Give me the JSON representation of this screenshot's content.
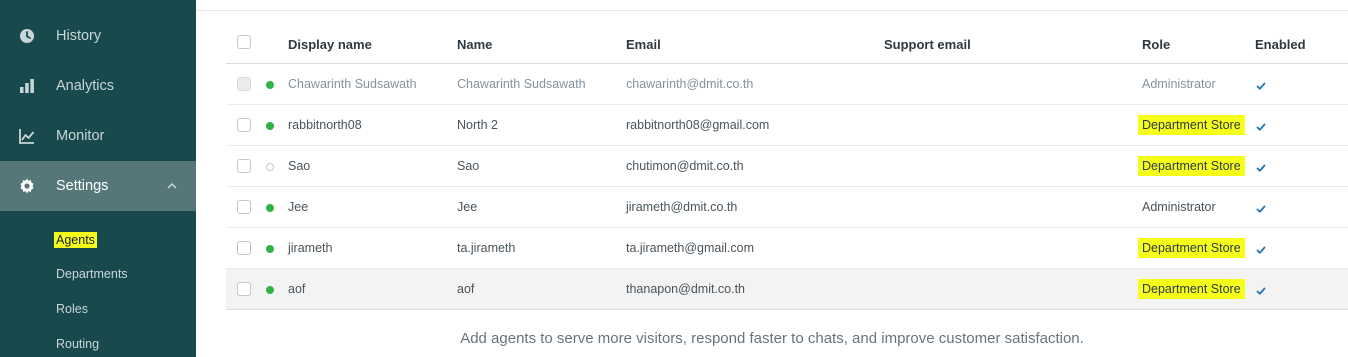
{
  "sidebar": {
    "items": [
      {
        "label": "History",
        "icon": "clock-icon"
      },
      {
        "label": "Analytics",
        "icon": "bar-chart-icon"
      },
      {
        "label": "Monitor",
        "icon": "line-chart-icon"
      },
      {
        "label": "Settings",
        "icon": "gear-icon",
        "active": true
      }
    ],
    "submenu": [
      {
        "label": "Agents",
        "active": true
      },
      {
        "label": "Departments"
      },
      {
        "label": "Roles"
      },
      {
        "label": "Routing"
      }
    ]
  },
  "table": {
    "headers": {
      "display_name": "Display name",
      "name": "Name",
      "email": "Email",
      "support_email": "Support email",
      "role": "Role",
      "enabled": "Enabled"
    },
    "rows": [
      {
        "display_name": "Chawarinth Sudsawath",
        "name": "Chawarinth Sudsawath",
        "email": "chawarinth@dmit.co.th",
        "support_email": "",
        "role": "Administrator",
        "status": "online",
        "enabled": true,
        "highlighted_role": false,
        "muted": true
      },
      {
        "display_name": "rabbitnorth08",
        "name": "North 2",
        "email": "rabbitnorth08@gmail.com",
        "support_email": "",
        "role": "Department Store",
        "status": "online",
        "enabled": true,
        "highlighted_role": true,
        "muted": false
      },
      {
        "display_name": "Sao",
        "name": "Sao",
        "email": "chutimon@dmit.co.th",
        "support_email": "",
        "role": "Department Store",
        "status": "offline",
        "enabled": true,
        "highlighted_role": true,
        "muted": false
      },
      {
        "display_name": "Jee",
        "name": "Jee",
        "email": "jirameth@dmit.co.th",
        "support_email": "",
        "role": "Administrator",
        "status": "online",
        "enabled": true,
        "highlighted_role": false,
        "muted": false
      },
      {
        "display_name": "jirameth",
        "name": "ta.jirameth",
        "email": "ta.jirameth@gmail.com",
        "support_email": "",
        "role": "Department Store",
        "status": "online",
        "enabled": true,
        "highlighted_role": true,
        "muted": false
      },
      {
        "display_name": "aof",
        "name": "aof",
        "email": "thanapon@dmit.co.th",
        "support_email": "",
        "role": "Department Store",
        "status": "online",
        "enabled": true,
        "highlighted_role": true,
        "muted": false
      }
    ]
  },
  "footer_message": "Add agents to serve more visitors, respond faster to chats, and improve customer satisfaction.",
  "colors": {
    "sidebar_bg": "#17494d",
    "sidebar_active": "#56777a",
    "highlight": "#f5ff1a",
    "online": "#2fb344",
    "check": "#1f73b7"
  }
}
